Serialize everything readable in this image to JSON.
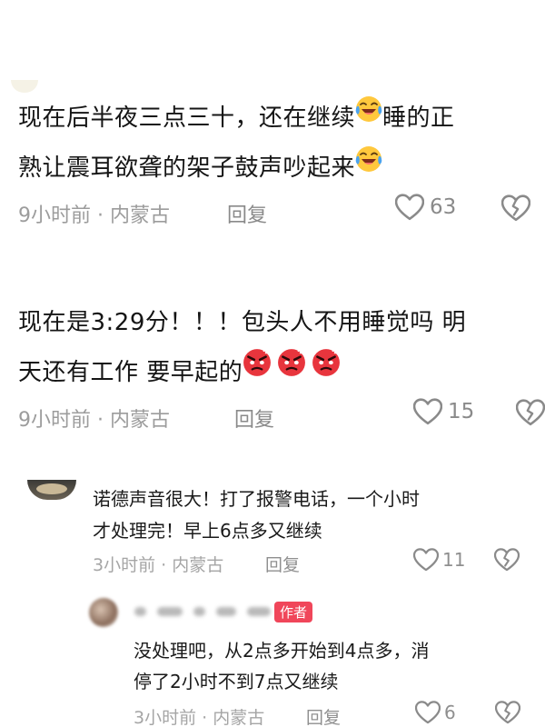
{
  "comments": [
    {
      "text_line1": "现在后半夜三点三十，还在继续",
      "text_line1b": "睡的正",
      "text_line2": "熟让震耳欲聋的架子鼓声吵起来",
      "emoji": "crying-laughing-emoji",
      "time_location": "9小时前 · 内蒙古",
      "reply_label": "回复",
      "likes": "63"
    },
    {
      "text_line1": "现在是3:29分！！！包头人不用睡觉吗 明",
      "text_line2": "天还有工作 要早起的",
      "emoji": "angry-face-emoji",
      "time_location": "9小时前 · 内蒙古",
      "reply_label": "回复",
      "likes": "15"
    }
  ],
  "replies": [
    {
      "text_line1": "诺德声音很大！打了报警电话，一个小时",
      "text_line2": "才处理完！早上6点多又继续",
      "time_location": "3小时前 · 内蒙古",
      "reply_label": "回复",
      "likes": "11"
    },
    {
      "author_badge": "作者",
      "text_line1": "没处理吧，从2点多开始到4点多，消",
      "text_line2": "停了2小时不到7点又继续",
      "time_location": "3小时前 · 内蒙古",
      "reply_label": "回复",
      "likes": "6"
    }
  ],
  "colors": {
    "meta_gray": "#9c9c9c",
    "author_badge_bg": "#f0465a",
    "emoji_yellow": "#ffc83d",
    "angry_red": "#e8353d"
  }
}
